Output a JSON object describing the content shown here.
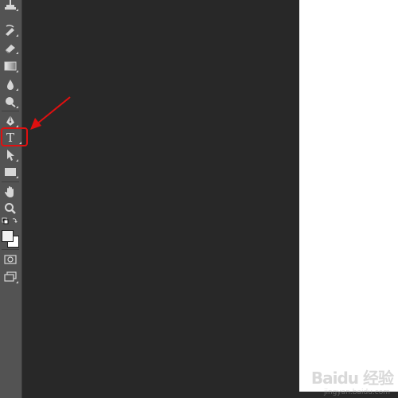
{
  "toolbar": {
    "tools": [
      {
        "name": "clone-stamp",
        "icon": "stamp-icon"
      },
      {
        "name": "history-brush",
        "icon": "history-brush-icon"
      },
      {
        "name": "eraser",
        "icon": "eraser-icon"
      },
      {
        "name": "gradient",
        "icon": "gradient-icon"
      },
      {
        "name": "blur",
        "icon": "blur-drop-icon"
      },
      {
        "name": "dodge",
        "icon": "dodge-icon"
      },
      {
        "name": "pen",
        "icon": "pen-icon"
      },
      {
        "name": "type",
        "icon": "type-icon",
        "glyph": "T",
        "highlighted": true
      },
      {
        "name": "path-selection",
        "icon": "arrow-cursor-icon"
      },
      {
        "name": "rectangle",
        "icon": "rectangle-icon"
      },
      {
        "name": "hand",
        "icon": "hand-icon"
      },
      {
        "name": "zoom",
        "icon": "magnifier-icon"
      },
      {
        "name": "quick-mask",
        "icon": "quick-mask-icon"
      },
      {
        "name": "screen-mode",
        "icon": "screen-mode-icon"
      }
    ],
    "foreground_color": "#f2f2f2",
    "background_color": "#ffffff"
  },
  "annotation": {
    "highlight_color": "#e01010",
    "arrow_icon": "red-arrow-icon"
  },
  "workspace": {
    "canvas_color": "#282828",
    "document_color": "#ffffff"
  },
  "watermark": {
    "text": "Baidu 经验",
    "sub": "jingyan.baidu.com"
  }
}
